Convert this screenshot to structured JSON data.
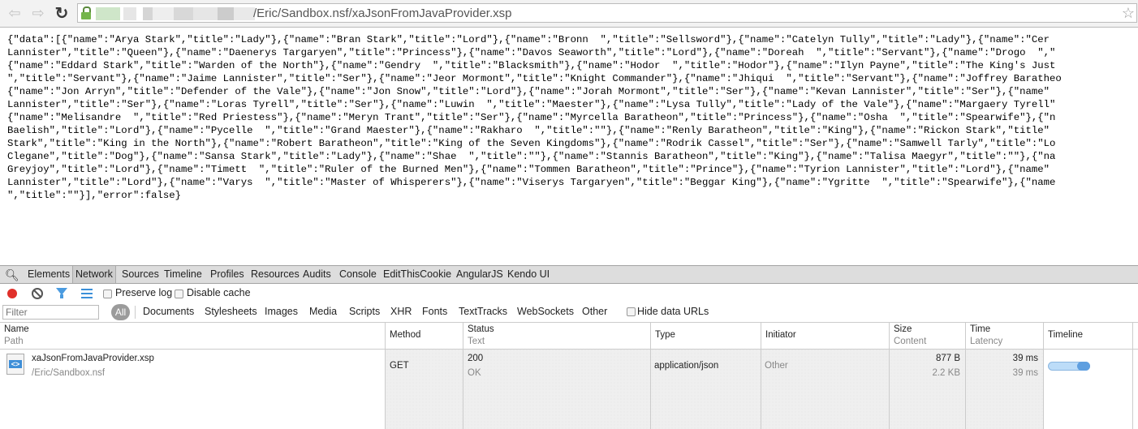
{
  "browser": {
    "back_icon": "back-arrow-icon",
    "forward_icon": "forward-arrow-icon",
    "reload_icon": "reload-icon",
    "lock_icon": "lock-icon",
    "url_visible": "/Eric/Sandbox.nsf/xaJsonFromJavaProvider.xsp",
    "bookmark_icon": "star-icon",
    "back_glyph": "⇦",
    "forward_glyph": "⇨",
    "reload_glyph": "↻",
    "star_glyph": "☆"
  },
  "page": {
    "json_lines": [
      "{\"data\":[{\"name\":\"Arya Stark\",\"title\":\"Lady\"},{\"name\":\"Bran Stark\",\"title\":\"Lord\"},{\"name\":\"Bronn  \",\"title\":\"Sellsword\"},{\"name\":\"Catelyn Tully\",\"title\":\"Lady\"},{\"name\":\"Cer",
      "Lannister\",\"title\":\"Queen\"},{\"name\":\"Daenerys Targaryen\",\"title\":\"Princess\"},{\"name\":\"Davos Seaworth\",\"title\":\"Lord\"},{\"name\":\"Doreah  \",\"title\":\"Servant\"},{\"name\":\"Drogo  \",\"",
      "{\"name\":\"Eddard Stark\",\"title\":\"Warden of the North\"},{\"name\":\"Gendry  \",\"title\":\"Blacksmith\"},{\"name\":\"Hodor  \",\"title\":\"Hodor\"},{\"name\":\"Ilyn Payne\",\"title\":\"The King's Just",
      "\",\"title\":\"Servant\"},{\"name\":\"Jaime Lannister\",\"title\":\"Ser\"},{\"name\":\"Jeor Mormont\",\"title\":\"Knight Commander\"},{\"name\":\"Jhiqui  \",\"title\":\"Servant\"},{\"name\":\"Joffrey Baratheo",
      "{\"name\":\"Jon Arryn\",\"title\":\"Defender of the Vale\"},{\"name\":\"Jon Snow\",\"title\":\"Lord\"},{\"name\":\"Jorah Mormont\",\"title\":\"Ser\"},{\"name\":\"Kevan Lannister\",\"title\":\"Ser\"},{\"name\"",
      "Lannister\",\"title\":\"Ser\"},{\"name\":\"Loras Tyrell\",\"title\":\"Ser\"},{\"name\":\"Luwin  \",\"title\":\"Maester\"},{\"name\":\"Lysa Tully\",\"title\":\"Lady of the Vale\"},{\"name\":\"Margaery Tyrell\"",
      "{\"name\":\"Melisandre  \",\"title\":\"Red Priestess\"},{\"name\":\"Meryn Trant\",\"title\":\"Ser\"},{\"name\":\"Myrcella Baratheon\",\"title\":\"Princess\"},{\"name\":\"Osha  \",\"title\":\"Spearwife\"},{\"n",
      "Baelish\",\"title\":\"Lord\"},{\"name\":\"Pycelle  \",\"title\":\"Grand Maester\"},{\"name\":\"Rakharo  \",\"title\":\"\"},{\"name\":\"Renly Baratheon\",\"title\":\"King\"},{\"name\":\"Rickon Stark\",\"title\"",
      "Stark\",\"title\":\"King in the North\"},{\"name\":\"Robert Baratheon\",\"title\":\"King of the Seven Kingdoms\"},{\"name\":\"Rodrik Cassel\",\"title\":\"Ser\"},{\"name\":\"Samwell Tarly\",\"title\":\"Lo",
      "Clegane\",\"title\":\"Dog\"},{\"name\":\"Sansa Stark\",\"title\":\"Lady\"},{\"name\":\"Shae  \",\"title\":\"\"},{\"name\":\"Stannis Baratheon\",\"title\":\"King\"},{\"name\":\"Talisa Maegyr\",\"title\":\"\"},{\"na",
      "Greyjoy\",\"title\":\"Lord\"},{\"name\":\"Timett  \",\"title\":\"Ruler of the Burned Men\"},{\"name\":\"Tommen Baratheon\",\"title\":\"Prince\"},{\"name\":\"Tyrion Lannister\",\"title\":\"Lord\"},{\"name\"",
      "Lannister\",\"title\":\"Lord\"},{\"name\":\"Varys  \",\"title\":\"Master of Whisperers\"},{\"name\":\"Viserys Targaryen\",\"title\":\"Beggar King\"},{\"name\":\"Ygritte  \",\"title\":\"Spearwife\"},{\"name",
      "\",\"title\":\"\"}],\"error\":false}"
    ]
  },
  "devtools": {
    "search_icon": "magnifier-icon",
    "tabs": [
      {
        "label": "Elements",
        "active": false
      },
      {
        "label": "Network",
        "active": true
      },
      {
        "label": "Sources",
        "active": false
      },
      {
        "label": "Timeline",
        "active": false
      },
      {
        "label": "Profiles",
        "active": false
      },
      {
        "label": "Resources",
        "active": false
      },
      {
        "label": "Audits",
        "active": false
      },
      {
        "label": "Console",
        "active": false
      },
      {
        "label": "EditThisCookie",
        "active": false
      },
      {
        "label": "AngularJS",
        "active": false
      },
      {
        "label": "Kendo UI",
        "active": false
      }
    ],
    "controls": {
      "record_icon": "record-icon",
      "clear_icon": "clear-icon",
      "filter_icon": "filter-icon",
      "list_icon": "large-rows-icon",
      "preserve_log": {
        "label": "Preserve log",
        "checked": false
      },
      "disable_cache": {
        "label": "Disable cache",
        "checked": false
      }
    },
    "filters": {
      "placeholder": "Filter",
      "value": "",
      "all_label": "All",
      "types": [
        "Documents",
        "Stylesheets",
        "Images",
        "Media",
        "Scripts",
        "XHR",
        "Fonts",
        "TextTracks",
        "WebSockets",
        "Other"
      ],
      "hide_data_urls": {
        "label": "Hide data URLs",
        "checked": false
      }
    },
    "columns": {
      "name": {
        "primary": "Name",
        "secondary": "Path"
      },
      "method": "Method",
      "status": {
        "primary": "Status",
        "secondary": "Text"
      },
      "type": "Type",
      "initiator": "Initiator",
      "size": {
        "primary": "Size",
        "secondary": "Content"
      },
      "time": {
        "primary": "Time",
        "secondary": "Latency"
      },
      "timeline": "Timeline"
    },
    "requests": [
      {
        "name": "xaJsonFromJavaProvider.xsp",
        "path": "/Eric/Sandbox.nsf",
        "file_icon": "script-file-icon",
        "method": "GET",
        "status": "200",
        "status_text": "OK",
        "type": "application/json",
        "initiator": "Other",
        "size": "877 B",
        "content": "2.2 KB",
        "time": "39 ms",
        "latency": "39 ms"
      }
    ]
  }
}
